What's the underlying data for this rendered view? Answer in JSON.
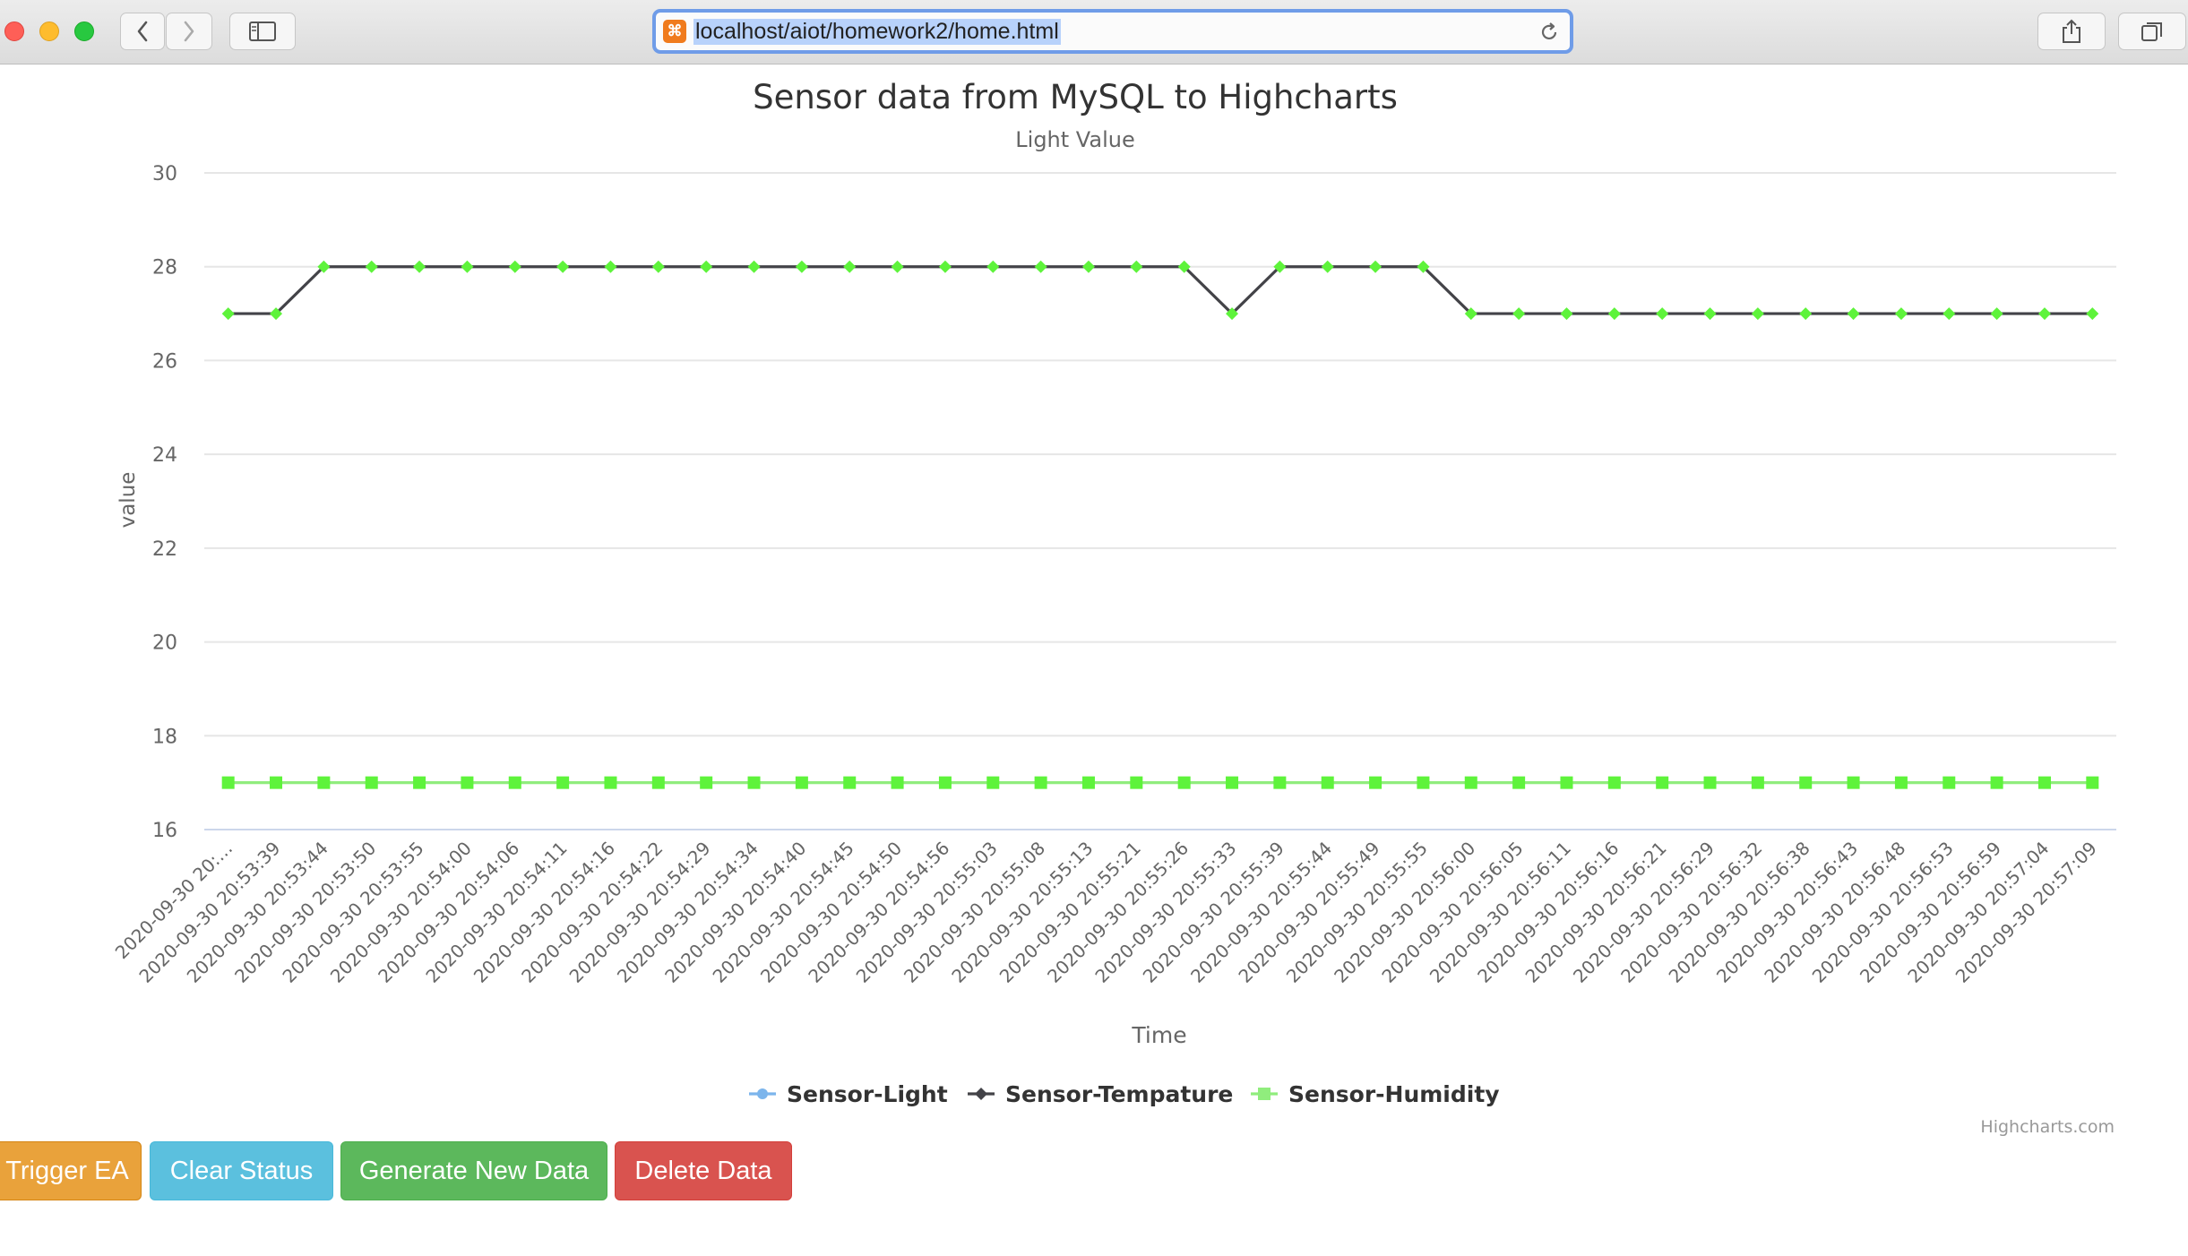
{
  "browser": {
    "url": "localhost/aiot/homework2/home.html"
  },
  "buttons": {
    "trigger": "Trigger EA",
    "clear": "Clear Status",
    "generate": "Generate New Data",
    "delete": "Delete Data"
  },
  "chart_data": {
    "type": "line",
    "title": "Sensor data from MySQL to Highcharts",
    "subtitle": "Light Value",
    "xlabel": "Time",
    "ylabel": "value",
    "ylim": [
      16,
      30
    ],
    "yticks": [
      16,
      18,
      20,
      22,
      24,
      26,
      28,
      30
    ],
    "grid": true,
    "legend_position": "bottom-center",
    "credits": "Highcharts.com",
    "categories": [
      "2020-09-30 20:…",
      "2020-09-30 20:53:39",
      "2020-09-30 20:53:44",
      "2020-09-30 20:53:50",
      "2020-09-30 20:53:55",
      "2020-09-30 20:54:00",
      "2020-09-30 20:54:06",
      "2020-09-30 20:54:11",
      "2020-09-30 20:54:16",
      "2020-09-30 20:54:22",
      "2020-09-30 20:54:29",
      "2020-09-30 20:54:34",
      "2020-09-30 20:54:40",
      "2020-09-30 20:54:45",
      "2020-09-30 20:54:50",
      "2020-09-30 20:54:56",
      "2020-09-30 20:55:03",
      "2020-09-30 20:55:08",
      "2020-09-30 20:55:13",
      "2020-09-30 20:55:21",
      "2020-09-30 20:55:26",
      "2020-09-30 20:55:33",
      "2020-09-30 20:55:39",
      "2020-09-30 20:55:44",
      "2020-09-30 20:55:49",
      "2020-09-30 20:55:55",
      "2020-09-30 20:56:00",
      "2020-09-30 20:56:05",
      "2020-09-30 20:56:11",
      "2020-09-30 20:56:16",
      "2020-09-30 20:56:21",
      "2020-09-30 20:56:29",
      "2020-09-30 20:56:32",
      "2020-09-30 20:56:38",
      "2020-09-30 20:56:43",
      "2020-09-30 20:56:48",
      "2020-09-30 20:56:53",
      "2020-09-30 20:56:59",
      "2020-09-30 20:57:04",
      "2020-09-30 20:57:09"
    ],
    "series": [
      {
        "name": "Sensor-Light",
        "color": "#7cb5ec",
        "marker": "circle",
        "values": []
      },
      {
        "name": "Sensor-Tempature",
        "color": "#434348",
        "marker": "diamond",
        "marker_color": "#5ef33b",
        "values": [
          27,
          27,
          28,
          28,
          28,
          28,
          28,
          28,
          28,
          28,
          28,
          28,
          28,
          28,
          28,
          28,
          28,
          28,
          28,
          28,
          28,
          27,
          28,
          28,
          28,
          28,
          27,
          27,
          27,
          27,
          27,
          27,
          27,
          27,
          27,
          27,
          27,
          27,
          27,
          27
        ]
      },
      {
        "name": "Sensor-Humidity",
        "color": "#90ed7d",
        "marker": "square",
        "marker_color": "#5ef33b",
        "values": [
          17,
          17,
          17,
          17,
          17,
          17,
          17,
          17,
          17,
          17,
          17,
          17,
          17,
          17,
          17,
          17,
          17,
          17,
          17,
          17,
          17,
          17,
          17,
          17,
          17,
          17,
          17,
          17,
          17,
          17,
          17,
          17,
          17,
          17,
          17,
          17,
          17,
          17,
          17,
          17
        ]
      }
    ]
  }
}
